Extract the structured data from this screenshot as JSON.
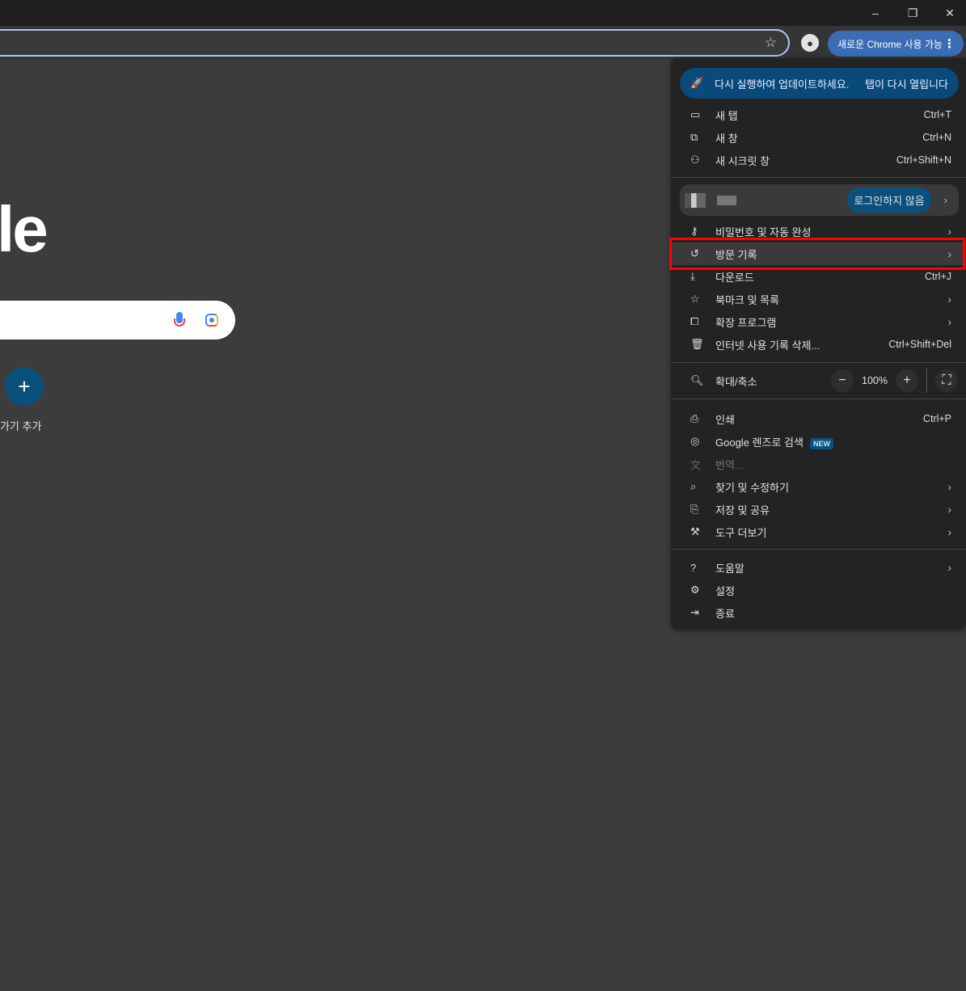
{
  "window": {
    "minimize": "–",
    "restore": "❐",
    "close": "✕"
  },
  "toolbar": {
    "bookmark_icon": "star-icon",
    "profile_icon": "person-icon",
    "update_chip": "새로운 Chrome 사용 가능",
    "menu_dots": "⋮"
  },
  "ntp": {
    "logo_fragment": "le",
    "shortcut_add_label": "로가기 추가",
    "shortcut_add_icon": "+"
  },
  "menu": {
    "banner": {
      "message": "다시 실행하여 업데이트하세요.",
      "action": "탭이 다시 열립니다"
    },
    "group1": [
      {
        "label": "새 탭",
        "shortcut": "Ctrl+T",
        "icon": "▭"
      },
      {
        "label": "새 창",
        "shortcut": "Ctrl+N",
        "icon": "⧉"
      },
      {
        "label": "새 시크릿 창",
        "shortcut": "Ctrl+Shift+N",
        "icon": "⚇"
      }
    ],
    "profile": {
      "status": "로그인하지 않음"
    },
    "group2": [
      {
        "label": "비밀번호 및 자동 완성",
        "shortcut": "",
        "icon": "⚷"
      },
      {
        "label": "방문 기록",
        "shortcut": "",
        "icon": "↺"
      },
      {
        "label": "다운로드",
        "shortcut": "Ctrl+J",
        "icon": "⤓"
      },
      {
        "label": "북마크 및 목록",
        "shortcut": "",
        "icon": "☆"
      },
      {
        "label": "확장 프로그램",
        "shortcut": "",
        "icon": "⧠"
      },
      {
        "label": "인터넷 사용 기록 삭제...",
        "shortcut": "Ctrl+Shift+Del",
        "icon": "🗑"
      }
    ],
    "zoom": {
      "label": "확대/축소",
      "value": "100%",
      "minus": "−",
      "plus": "+",
      "fullscreen": "⛶"
    },
    "group3": [
      {
        "label": "인쇄",
        "shortcut": "Ctrl+P",
        "icon": "⎙"
      },
      {
        "label": "Google 렌즈로 검색",
        "badge": "NEW",
        "icon": "◎"
      },
      {
        "label": "번역...",
        "shortcut": "",
        "icon": "文"
      },
      {
        "label": "찾기 및 수정하기",
        "shortcut": "",
        "icon": "⌕"
      },
      {
        "label": "저장 및 공유",
        "shortcut": "",
        "icon": "⎘"
      },
      {
        "label": "도구 더보기",
        "shortcut": "",
        "icon": "⚒"
      }
    ],
    "group4": [
      {
        "label": "도움말",
        "icon": "?"
      },
      {
        "label": "설정",
        "icon": "⚙"
      },
      {
        "label": "종료",
        "icon": "⇥"
      }
    ],
    "chevron": "›"
  },
  "colors": {
    "highlight_box": "#ff0000",
    "accent": "#0b4f7c",
    "update_chip": "#3a6db5"
  }
}
